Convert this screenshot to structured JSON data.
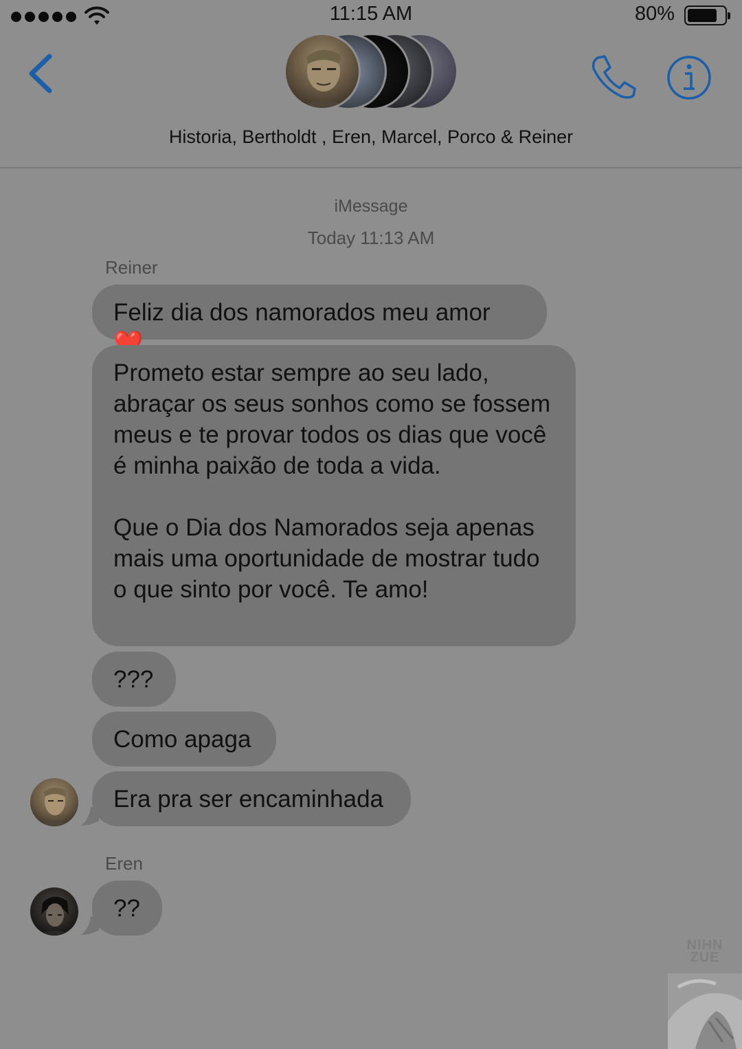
{
  "status_bar": {
    "time": "11:15 AM",
    "battery_percent": "80%",
    "battery_level": 0.8,
    "signal_bars": 5
  },
  "header": {
    "participants": "Historia, Bertholdt , Eren, Marcel, Porco & Reiner",
    "icons": [
      "chevron-left-icon",
      "phone-icon",
      "info-icon"
    ],
    "accent_color": "#1c5fa8"
  },
  "thread": {
    "service": "iMessage",
    "timestamp": "Today 11:13 AM",
    "reiner": {
      "name": "Reiner",
      "messages": {
        "m1": "Feliz dia dos namorados meu amor ❤️",
        "m2": {
          "p1": "Prometo estar sempre ao seu lado, abraçar os seus sonhos como se fossem meus e te provar todos os dias que você é minha paixão de toda a vida.",
          "p2": "Que o Dia dos Namorados seja apenas mais uma oportunidade de mostrar tudo o que sinto por você. Te amo!"
        },
        "m3": "???",
        "m4": "Como apaga",
        "m5": "Era pra ser encaminhada"
      }
    },
    "eren": {
      "name": "Eren",
      "messages": {
        "m1": "??"
      }
    }
  },
  "watermark": {
    "text": "NIHN ZUE"
  }
}
